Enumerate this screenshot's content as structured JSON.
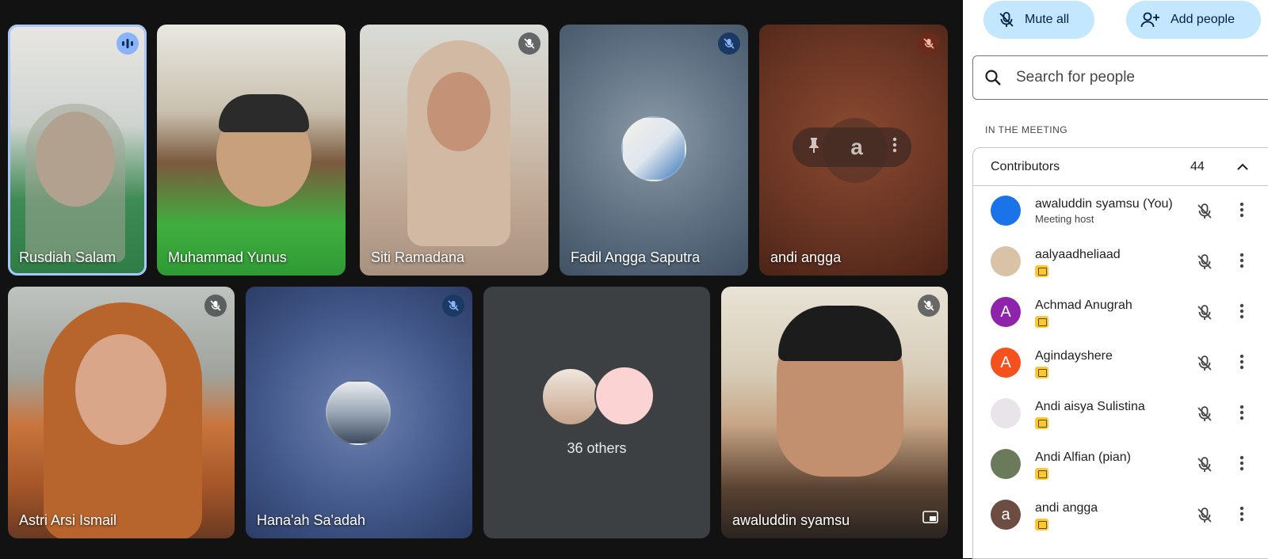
{
  "tiles": [
    {
      "name": "Rusdiah Salam"
    },
    {
      "name": "Muhammad Yunus"
    },
    {
      "name": "Siti Ramadana"
    },
    {
      "name": "Fadil Angga Saputra"
    },
    {
      "name": "andi angga"
    },
    {
      "name": "Astri Arsi Ismail"
    },
    {
      "name": "Hana'ah Sa'adah"
    },
    {
      "name": "awaluddin syamsu"
    }
  ],
  "others_label": "36 others",
  "panel": {
    "mute_all": "Mute all",
    "add_people": "Add people",
    "search_placeholder": "Search for people",
    "section_label": "IN THE MEETING",
    "group_title": "Contributors",
    "group_count": "44",
    "people": [
      {
        "name": "awaluddin syamsu (You)",
        "sub": "Meeting host",
        "avatar_letter": "",
        "avatar_color": "#1a73e8"
      },
      {
        "name": "aalyaadheliaad",
        "sub": "",
        "avatar_letter": "",
        "avatar_color": "#d9c2a6"
      },
      {
        "name": "Achmad Anugrah",
        "sub": "",
        "avatar_letter": "A",
        "avatar_color": "#8e24aa"
      },
      {
        "name": "Agindayshere",
        "sub": "",
        "avatar_letter": "A",
        "avatar_color": "#f4511e"
      },
      {
        "name": "Andi aisya Sulistina",
        "sub": "",
        "avatar_letter": "",
        "avatar_color": "#e8e4ea"
      },
      {
        "name": "Andi Alfian (pian)",
        "sub": "",
        "avatar_letter": "",
        "avatar_color": "#6a7a5a"
      },
      {
        "name": "andi angga",
        "sub": "",
        "avatar_letter": "a",
        "avatar_color": "#6d4c41"
      }
    ]
  },
  "colors": {
    "accent_button": "#c2e7ff",
    "raised_hand": "#fcc934",
    "speaking_outline": "#a8c7fa"
  }
}
